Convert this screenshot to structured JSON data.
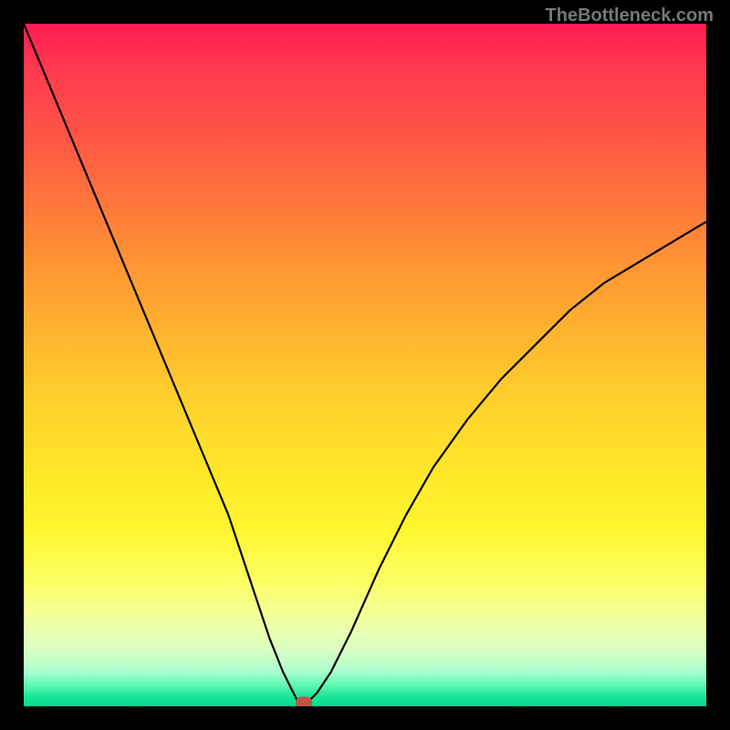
{
  "watermark": "TheBottleneck.com",
  "chart_data": {
    "type": "line",
    "title": "",
    "xlabel": "",
    "ylabel": "",
    "xlim": [
      0,
      100
    ],
    "ylim": [
      0,
      100
    ],
    "series": [
      {
        "name": "curve",
        "x": [
          0,
          5,
          10,
          15,
          20,
          25,
          30,
          33,
          36,
          38,
          40,
          41,
          42,
          43,
          45,
          48,
          52,
          56,
          60,
          65,
          70,
          75,
          80,
          85,
          90,
          95,
          100
        ],
        "values": [
          100,
          88,
          76,
          64,
          52,
          40,
          28,
          19,
          10,
          5,
          1,
          0.5,
          1,
          2,
          5,
          11,
          20,
          28,
          35,
          42,
          48,
          53,
          58,
          62,
          65,
          68,
          71
        ]
      }
    ],
    "marker": {
      "x": 41,
      "y": 0.5
    },
    "colors": {
      "curve": "#000000",
      "marker": "#c05548",
      "gradient_top": "#ff1a53",
      "gradient_bottom": "#00d98c"
    }
  }
}
